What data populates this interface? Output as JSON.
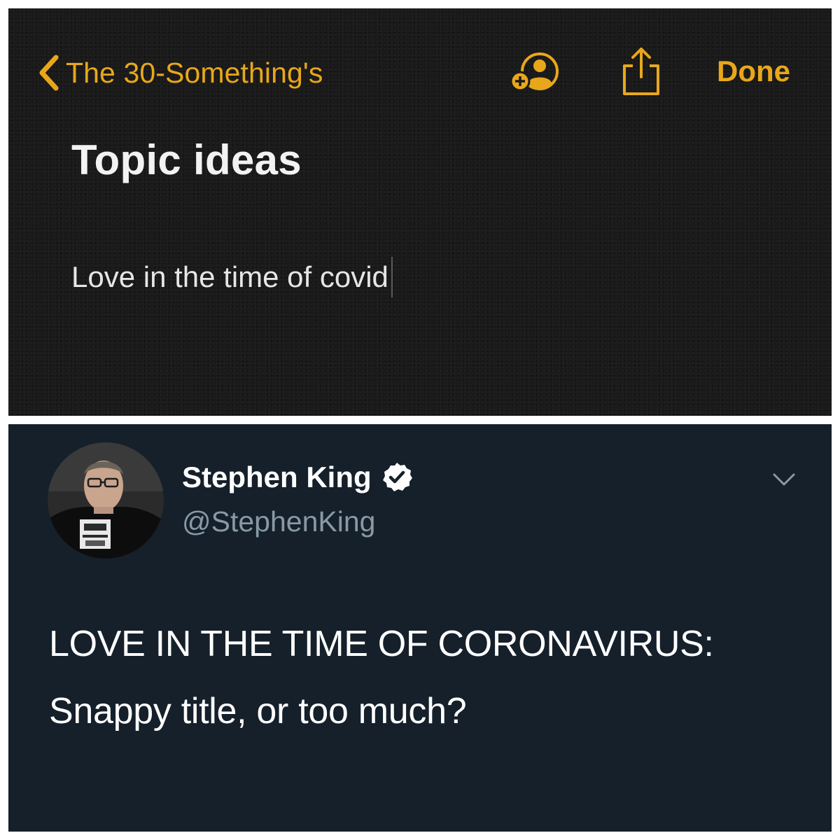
{
  "notes": {
    "back_label": "The 30-Something's",
    "done_label": "Done",
    "note_title": "Topic ideas",
    "note_body": "Love in the time of covid",
    "icons": {
      "back": "chevron-left-icon",
      "add_people": "add-person-icon",
      "share": "share-icon"
    },
    "colors": {
      "accent": "#e8a71b",
      "background": "#1a1a1a",
      "text": "#f2f2f2"
    }
  },
  "tweet": {
    "author_name": "Stephen King",
    "handle": "@StephenKing",
    "verified": true,
    "text": "LOVE IN THE TIME OF CORONAVIRUS: Snappy title, or too much?",
    "icons": {
      "verified": "verified-badge-icon",
      "menu": "chevron-down-icon"
    },
    "colors": {
      "background": "#15202b",
      "handle": "#8899a6",
      "text": "#ffffff"
    }
  }
}
